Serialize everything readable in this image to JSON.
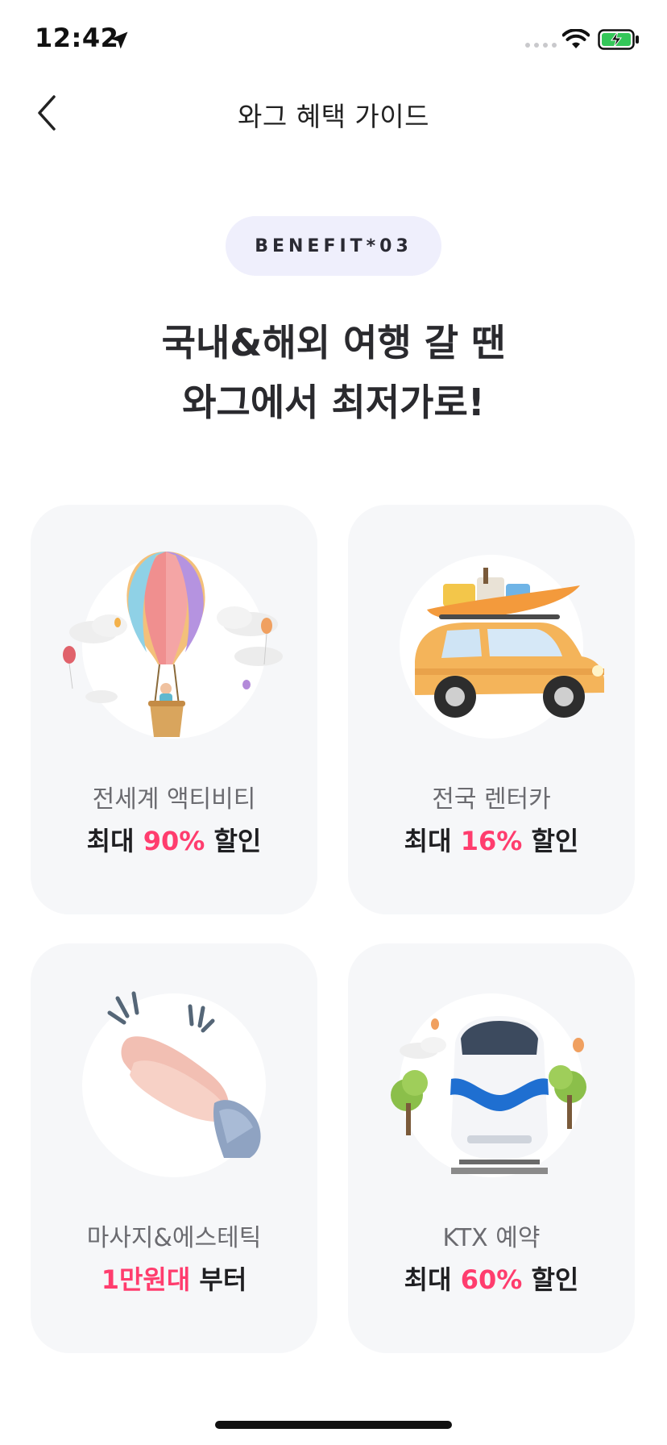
{
  "status_bar": {
    "time": "12:42",
    "icons": [
      "location-arrow-icon",
      "signal-icon",
      "wifi-icon",
      "battery-charging-icon"
    ],
    "battery_color": "#34c759"
  },
  "nav": {
    "back_icon": "chevron-left-icon",
    "title": "와그 혜택 가이드"
  },
  "badge": {
    "text": "BENEFIT*03"
  },
  "headline": {
    "line1": "국내&해외 여행 갈 땐",
    "line2": "와그에서 최저가로!"
  },
  "colors": {
    "accent": "#ff3d6e",
    "card_bg": "#f6f7f9",
    "badge_bg": "#efeffc"
  },
  "cards": [
    {
      "icon": "hot-air-balloon-icon",
      "label": "전세계 액티비티",
      "prefix": "최대 ",
      "highlight": "90%",
      "suffix": " 할인"
    },
    {
      "icon": "car-icon",
      "label": "전국 렌터카",
      "prefix": "최대 ",
      "highlight": "16%",
      "suffix": " 할인"
    },
    {
      "icon": "clapping-hands-icon",
      "label": "마사지&에스테틱",
      "prefix": "",
      "highlight": "1만원대",
      "suffix": " 부터"
    },
    {
      "icon": "train-icon",
      "label": "KTX 예약",
      "prefix": "최대 ",
      "highlight": "60%",
      "suffix": " 할인"
    }
  ]
}
